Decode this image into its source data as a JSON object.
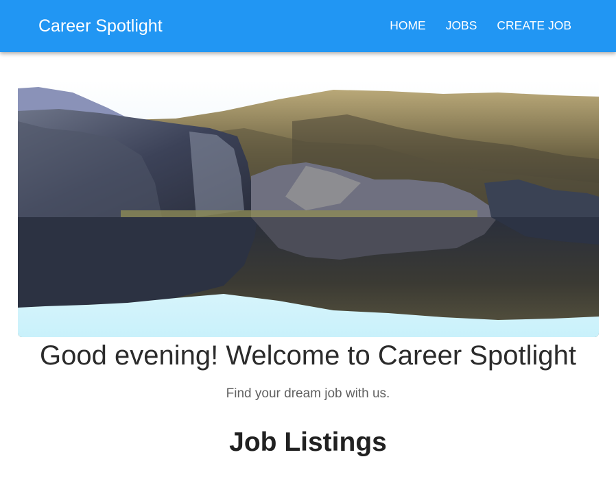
{
  "navbar": {
    "brand": "Career Spotlight",
    "links": [
      {
        "label": "HOME"
      },
      {
        "label": "JOBS"
      },
      {
        "label": "CREATE JOB"
      }
    ],
    "background_color": "#2196f3"
  },
  "hero": {
    "image": "mountain-lake-reflection-photo"
  },
  "main": {
    "welcome": "Good evening! Welcome to Career Spotlight",
    "subtitle": "Find your dream job with us.",
    "section_title": "Job Listings"
  }
}
